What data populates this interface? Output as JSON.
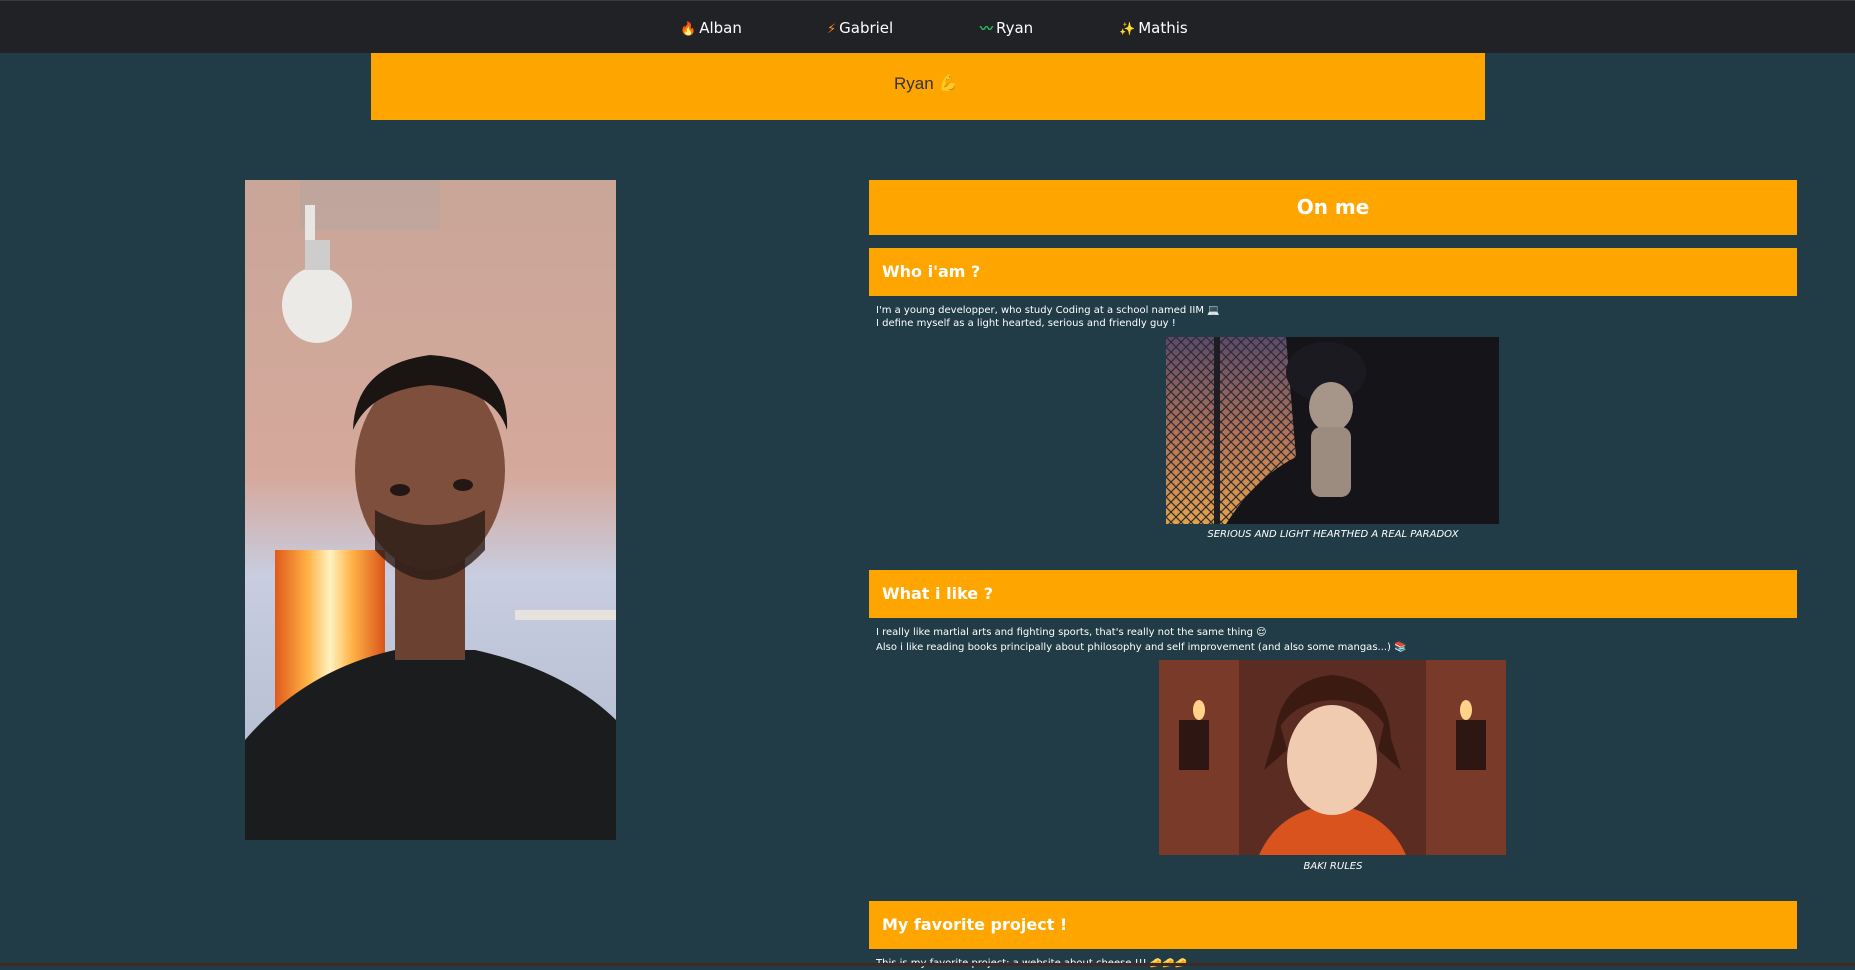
{
  "nav": {
    "items": [
      {
        "glyph": "🔥",
        "label": "Alban"
      },
      {
        "glyph": "⚡",
        "label": "Gabriel"
      },
      {
        "glyph": "〰",
        "label": "Ryan"
      },
      {
        "glyph": "✨",
        "label": "Mathis"
      }
    ]
  },
  "banner": {
    "title": "Ryan 💪"
  },
  "main": {
    "heading": "On me",
    "sections": [
      {
        "title": "Who i'am ?",
        "lines": [
          "I'm a young developper, who study Coding at a school named IIM 💻",
          "I define myself as a light hearted, serious and friendly guy !"
        ],
        "caption": "SERIOUS AND LIGHT HEARTHED A REAL PARADOX"
      },
      {
        "title": "What i like ?",
        "lines": [
          "I really like martial arts and fighting sports, that's really not the same thing 😌",
          "Also i like reading books principally about philosophy and self improvement (and also some mangas...) 📚"
        ],
        "caption": "BAKI RULES"
      },
      {
        "title": "My favorite project !",
        "lines": [
          "This is my favorite project: a website about cheese !!! 🧀🧀🧀"
        ]
      }
    ]
  },
  "colors": {
    "background": "#213c47",
    "accent": "#ffa500",
    "navbar": "#212226"
  }
}
